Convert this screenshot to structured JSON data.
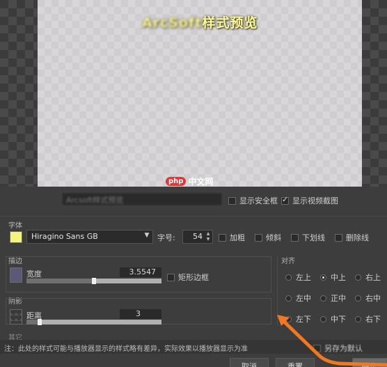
{
  "preview": {
    "text_blurred": "ArcSoft",
    "text_clear": "样式预览",
    "text_color": "#fff8a0"
  },
  "toolbar": {
    "font_name_value": "Arcsoft样式预览",
    "show_safe_frame_label": "显示安全框",
    "show_safe_frame_checked": false,
    "show_video_screenshot_label": "显示视频截图",
    "show_video_screenshot_checked": true
  },
  "watermark": {
    "badge": "php",
    "text": "中文网"
  },
  "font_group": {
    "label": "字体",
    "color": "#f5f47a",
    "font_family": "Hiragino Sans GB",
    "size_label": "字号:",
    "size_value": "54",
    "options": [
      "加粗",
      "倾斜",
      "下划线",
      "删除线"
    ]
  },
  "stroke_group": {
    "label": "描边",
    "width_label": "宽度",
    "width_value": "3.5547",
    "width_fraction": 0.5,
    "rect_border_label": "矩形边框"
  },
  "shadow_group": {
    "label": "阴影",
    "distance_label": "距离",
    "distance_value": "3",
    "distance_fraction": 0.1
  },
  "more_label": "其它",
  "align_group": {
    "label": "对齐",
    "options": [
      [
        "左上",
        "中上",
        "右上"
      ],
      [
        "左中",
        "正中",
        "右中"
      ],
      [
        "左下",
        "中下",
        "右下"
      ]
    ],
    "selected": "中上"
  },
  "note": "注：此处的样式可能与播放器显示的样式略有差异，实际效果以播放器显示为准",
  "save_default_label": "另存为默认",
  "buttons": {
    "cancel": "取消",
    "reset": "重置",
    "ok": "确定"
  }
}
